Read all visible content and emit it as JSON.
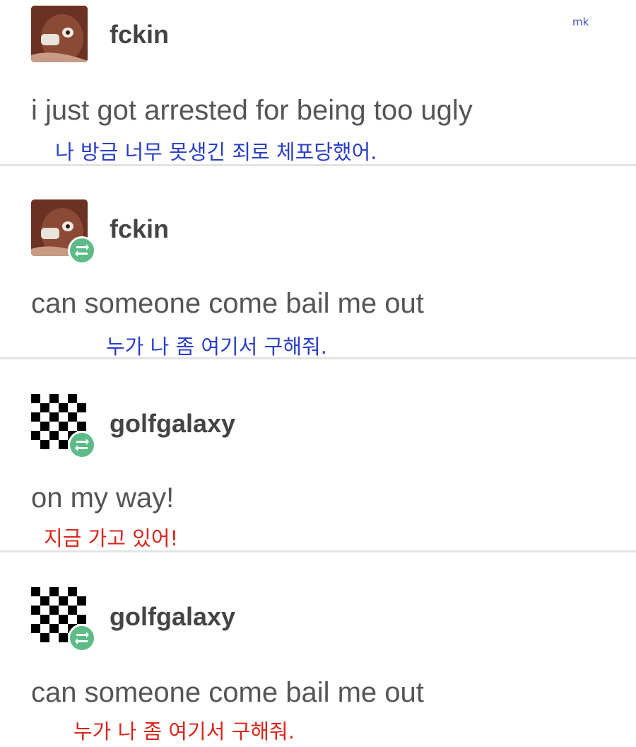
{
  "watermark": "mk",
  "colors": {
    "translation_blue": "#2a3fc7",
    "translation_red": "#d8261c",
    "reblog_badge": "#5dbb87",
    "text": "#555555",
    "username": "#444444"
  },
  "posts": [
    {
      "username": "fckin",
      "avatar": "photo-avatar",
      "reblogged": false,
      "message": "i just got arrested for being too ugly",
      "translation": "나 방금 너무 못생긴 죄로 체포당했어.",
      "translation_color": "blue"
    },
    {
      "username": "fckin",
      "avatar": "photo-avatar",
      "reblogged": true,
      "message": "can someone come bail me out",
      "translation": "누가 나 좀 여기서 구해줘.",
      "translation_color": "blue"
    },
    {
      "username": "golfgalaxy",
      "avatar": "checkerboard-avatar",
      "reblogged": true,
      "message": "on my way!",
      "translation": "지금 가고 있어!",
      "translation_color": "red"
    },
    {
      "username": "golfgalaxy",
      "avatar": "checkerboard-avatar",
      "reblogged": true,
      "message": "can someone come bail me out",
      "translation": "누가 나 좀 여기서 구해줘.",
      "translation_color": "red"
    }
  ]
}
